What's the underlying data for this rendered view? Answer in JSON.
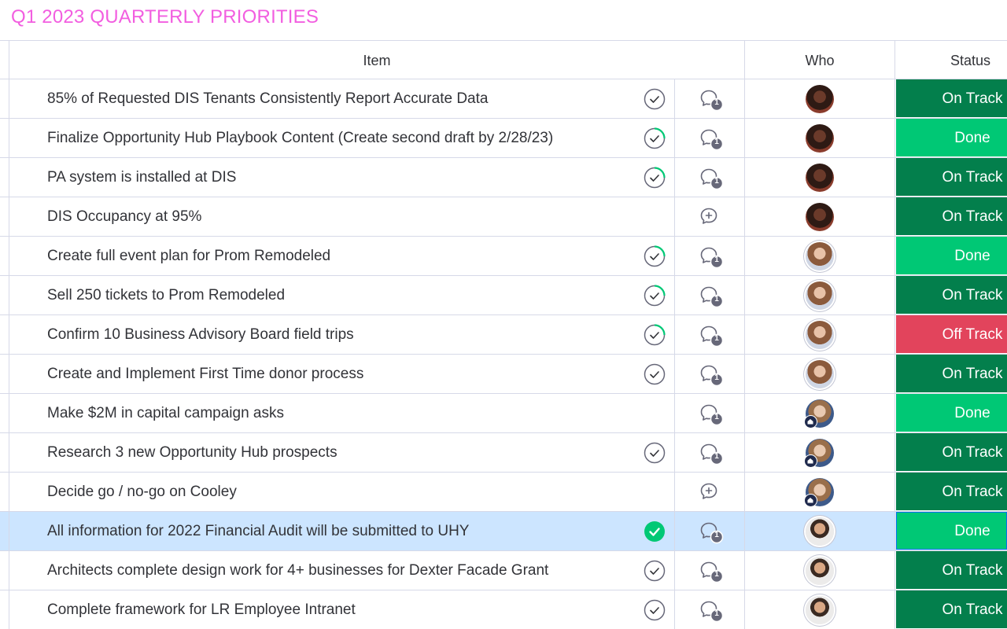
{
  "board": {
    "group_title": "Q1 2023 QUARTERLY PRIORITIES",
    "columns": {
      "item": "Item",
      "who": "Who",
      "status": "Status"
    }
  },
  "colors": {
    "group_title": "#f25ee0",
    "on_track": "#037f4c",
    "done": "#00c875",
    "off_track": "#e2445c",
    "selected_row": "#cce5ff",
    "check_done_fill": "#00c875"
  },
  "rows": [
    {
      "item": "85% of Requested DIS Tenants Consistently Report Accurate Data",
      "check": "grey-check-icon",
      "update": "chat-bubble-count-icon",
      "update_count": "1",
      "person": "person-a",
      "status": "On Track"
    },
    {
      "item": "Finalize Opportunity Hub Playbook Content (Create second draft by 2/28/23)",
      "check": "green-partial-check-icon",
      "update": "chat-bubble-count-icon",
      "update_count": "1",
      "person": "person-a",
      "status": "Done"
    },
    {
      "item": "PA system is installed at DIS",
      "check": "green-partial-check-icon",
      "update": "chat-bubble-count-icon",
      "update_count": "1",
      "person": "person-a",
      "status": "On Track"
    },
    {
      "item": "DIS Occupancy at 95%",
      "check": "",
      "update": "add-update-icon",
      "update_count": "",
      "person": "person-a",
      "status": "On Track"
    },
    {
      "item": "Create full event plan for Prom Remodeled",
      "check": "green-partial-check-icon",
      "update": "chat-bubble-count-icon",
      "update_count": "1",
      "person": "person-b",
      "status": "Done"
    },
    {
      "item": "Sell 250 tickets to Prom Remodeled",
      "check": "green-partial-check-icon",
      "update": "chat-bubble-count-icon",
      "update_count": "1",
      "person": "person-b",
      "status": "On Track"
    },
    {
      "item": "Confirm 10 Business Advisory Board field trips",
      "check": "green-partial-check-icon",
      "update": "chat-bubble-count-icon",
      "update_count": "1",
      "person": "person-b",
      "status": "Off Track"
    },
    {
      "item": "Create and Implement First Time donor process",
      "check": "grey-check-icon",
      "update": "chat-bubble-count-icon",
      "update_count": "1",
      "person": "person-b",
      "status": "On Track"
    },
    {
      "item": "Make $2M in capital campaign asks",
      "check": "",
      "update": "chat-bubble-count-icon",
      "update_count": "1",
      "person": "person-c",
      "status": "Done"
    },
    {
      "item": "Research 3 new Opportunity Hub prospects",
      "check": "grey-check-icon",
      "update": "chat-bubble-count-icon",
      "update_count": "1",
      "person": "person-c",
      "status": "On Track"
    },
    {
      "item": "Decide go / no-go on Cooley",
      "check": "",
      "update": "add-update-icon",
      "update_count": "",
      "person": "person-c",
      "status": "On Track"
    },
    {
      "item": "All information for 2022 Financial Audit will be submitted to UHY",
      "check": "filled-green-check-icon",
      "update": "chat-bubble-count-icon",
      "update_count": "1",
      "person": "person-d",
      "status": "Done",
      "selected": true
    },
    {
      "item": "Architects complete design work for 4+ businesses for Dexter Facade Grant",
      "check": "grey-check-icon",
      "update": "chat-bubble-count-icon",
      "update_count": "1",
      "person": "person-d",
      "status": "On Track"
    },
    {
      "item": "Complete framework for LR Employee Intranet",
      "check": "grey-check-icon",
      "update": "chat-bubble-count-icon",
      "update_count": "1",
      "person": "person-d",
      "status": "On Track"
    }
  ]
}
